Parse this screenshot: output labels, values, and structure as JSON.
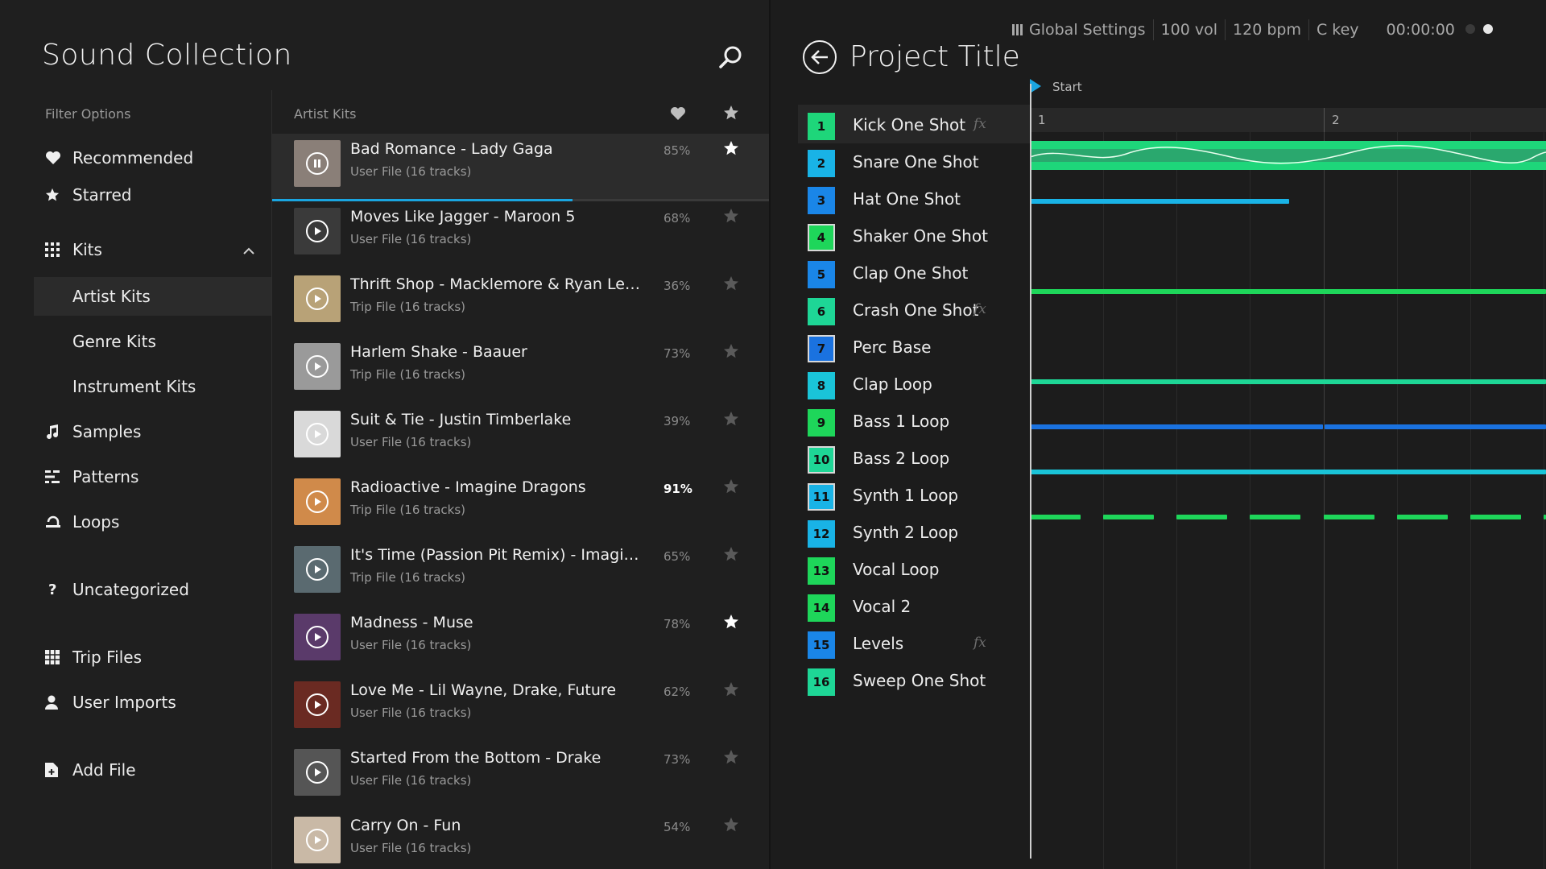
{
  "app": {
    "title": "Sound Collection",
    "search_icon": "search-icon"
  },
  "filters": {
    "heading": "Filter Options",
    "items": [
      {
        "label": "Recommended",
        "icon": "heart-icon"
      },
      {
        "label": "Starred",
        "icon": "star-icon"
      },
      {
        "label": "Kits",
        "icon": "grid-icon",
        "expanded": true
      },
      {
        "label": "Artist Kits",
        "selected": true
      },
      {
        "label": "Genre Kits"
      },
      {
        "label": "Instrument Kits"
      },
      {
        "label": "Samples",
        "icon": "music-note-icon"
      },
      {
        "label": "Patterns",
        "icon": "patterns-icon"
      },
      {
        "label": "Loops",
        "icon": "loop-icon"
      },
      {
        "label": "Uncategorized",
        "icon": "question-icon"
      },
      {
        "label": "Trip Files",
        "icon": "trip-file-icon"
      },
      {
        "label": "User Imports",
        "icon": "user-icon"
      },
      {
        "label": "Add File",
        "icon": "add-file-icon"
      }
    ]
  },
  "kit_list": {
    "header": "Artist Kits",
    "rows": [
      {
        "title": "Bad Romance - Lady Gaga",
        "sub": "User File (16 tracks)",
        "pct": "85%",
        "starred": true,
        "playing": true,
        "progress": 0.605,
        "thumb": "#8a7f78"
      },
      {
        "title": "Moves Like Jagger - Maroon 5",
        "sub": "User File (16 tracks)",
        "pct": "68%",
        "starred": false,
        "thumb": "#3a3a3a"
      },
      {
        "title": "Thrift Shop - Macklemore & Ryan Lewis",
        "sub": "Trip File (16 tracks)",
        "pct": "36%",
        "starred": false,
        "thumb": "#b8a277"
      },
      {
        "title": "Harlem Shake - Baauer",
        "sub": "Trip File (16 tracks)",
        "pct": "73%",
        "starred": false,
        "thumb": "#9a9a9a"
      },
      {
        "title": "Suit & Tie - Justin Timberlake",
        "sub": "User File (16 tracks)",
        "pct": "39%",
        "starred": false,
        "thumb": "#d9d9d9"
      },
      {
        "title": "Radioactive - Imagine Dragons",
        "sub": "Trip File (16 tracks)",
        "pct": "91%",
        "starred": false,
        "highlight": true,
        "thumb": "#d08a4a"
      },
      {
        "title": "It's Time (Passion Pit Remix) - Imagine...",
        "sub": "Trip File (16 tracks)",
        "pct": "65%",
        "starred": false,
        "thumb": "#5a6a70"
      },
      {
        "title": "Madness - Muse",
        "sub": "User File (16 tracks)",
        "pct": "78%",
        "starred": true,
        "thumb": "#5a3a6a"
      },
      {
        "title": "Love Me - Lil Wayne, Drake, Future",
        "sub": "User File (16 tracks)",
        "pct": "62%",
        "starred": false,
        "thumb": "#6a2a22"
      },
      {
        "title": "Started From the Bottom - Drake",
        "sub": "User File (16 tracks)",
        "pct": "73%",
        "starred": false,
        "thumb": "#555555"
      },
      {
        "title": "Carry On - Fun",
        "sub": "User File (16 tracks)",
        "pct": "54%",
        "starred": false,
        "thumb": "#c9b9a6"
      }
    ]
  },
  "project": {
    "title": "Project Title",
    "global_settings": "Global Settings",
    "volume": "100 vol",
    "tempo": "120 bpm",
    "key": "C key",
    "time": "00:00:00",
    "start_label": "Start",
    "ruler": [
      "1",
      "2"
    ],
    "tracks": [
      {
        "num": "1",
        "name": "Kick One Shot",
        "fx": true,
        "color": "#1ed67a"
      },
      {
        "num": "2",
        "name": "Snare One Shot",
        "color": "#19b3e6"
      },
      {
        "num": "3",
        "name": "Hat One Shot",
        "color": "#1a86e8"
      },
      {
        "num": "4",
        "name": "Shaker One Shot",
        "color": "#1ed65a",
        "outlined": true
      },
      {
        "num": "5",
        "name": "Clap One Shot",
        "color": "#1a86e8"
      },
      {
        "num": "6",
        "name": "Crash One Shot",
        "fx": true,
        "color": "#1ed696"
      },
      {
        "num": "7",
        "name": "Perc Base",
        "color": "#1a72e0",
        "outlined": true
      },
      {
        "num": "8",
        "name": "Clap Loop",
        "color": "#1ac4d8"
      },
      {
        "num": "9",
        "name": "Bass 1 Loop",
        "color": "#1ed65a"
      },
      {
        "num": "10",
        "name": "Bass 2 Loop",
        "color": "#1ed696",
        "outlined": true
      },
      {
        "num": "11",
        "name": "Synth 1 Loop",
        "color": "#19b3e6",
        "outlined": true
      },
      {
        "num": "12",
        "name": "Synth 2 Loop",
        "color": "#19b3e6"
      },
      {
        "num": "13",
        "name": "Vocal Loop",
        "color": "#1ed65a"
      },
      {
        "num": "14",
        "name": "Vocal 2",
        "color": "#1ed65a"
      },
      {
        "num": "15",
        "name": "Levels",
        "fx": true,
        "color": "#1a86e8"
      },
      {
        "num": "16",
        "name": "Sweep One Shot",
        "color": "#1ed696"
      }
    ]
  }
}
